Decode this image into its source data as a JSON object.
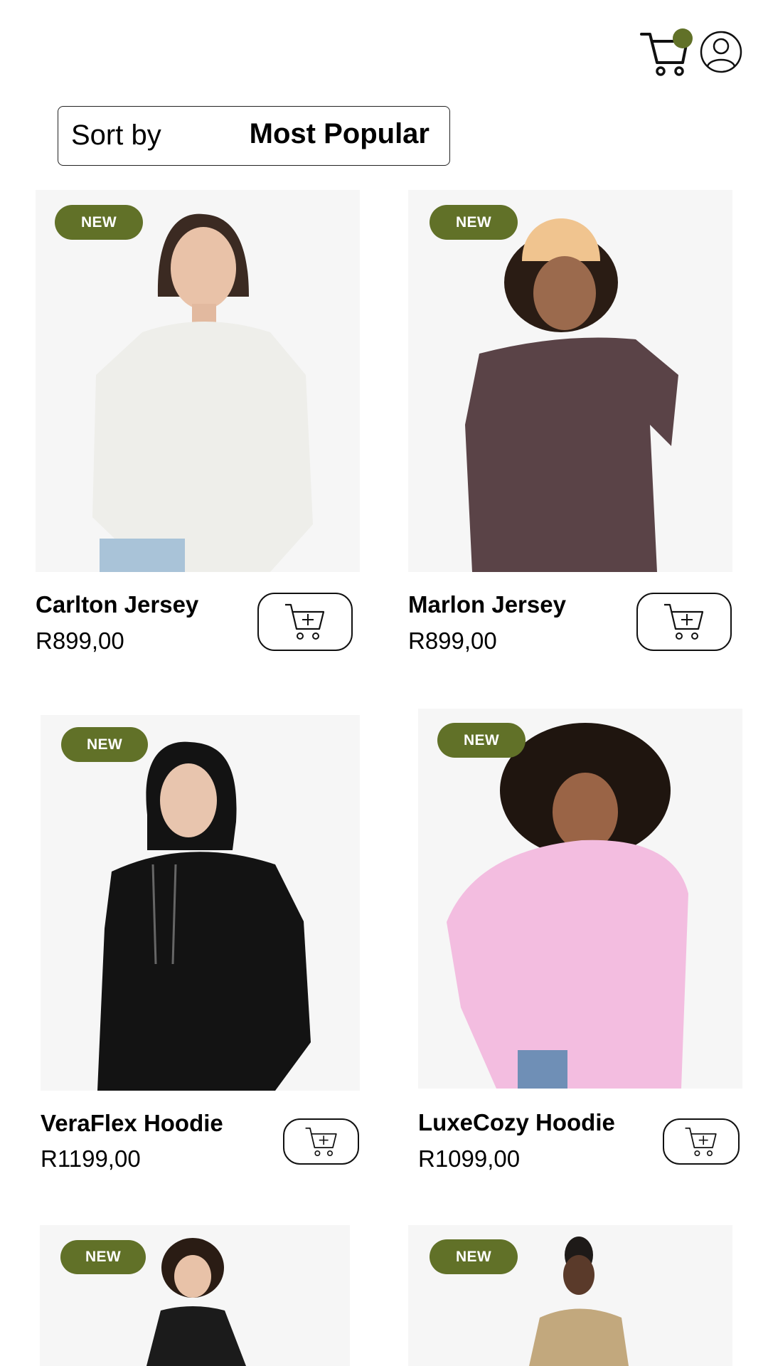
{
  "header": {
    "cart_icon": "shopping-cart-icon",
    "cart_indicator_color": "#617128",
    "profile_icon": "user-profile-icon"
  },
  "sort": {
    "label": "Sort by",
    "value": "Most Popular"
  },
  "accent_color": "#617128",
  "products": [
    {
      "badge": "NEW",
      "name": "Carlton Jersey",
      "price": "R899,00",
      "garment_color": "#eeeeea",
      "image": "woman-white-sweatshirt"
    },
    {
      "badge": "NEW",
      "name": "Marlon Jersey",
      "price": "R899,00",
      "garment_color": "#5a4347",
      "image": "woman-brown-sweatshirt-beanie"
    },
    {
      "badge": "NEW",
      "name": "VeraFlex Hoodie",
      "price": "R1199,00",
      "garment_color": "#131313",
      "image": "woman-black-hoodie"
    },
    {
      "badge": "NEW",
      "name": "LuxeCozy Hoodie",
      "price": "R1099,00",
      "garment_color": "#f3bde0",
      "image": "woman-pink-hoodie"
    },
    {
      "badge": "NEW",
      "image": "woman-black-top",
      "garment_color": "#1b1b1b"
    },
    {
      "badge": "NEW",
      "image": "woman-beige-turtleneck",
      "garment_color": "#c2a87d"
    }
  ]
}
